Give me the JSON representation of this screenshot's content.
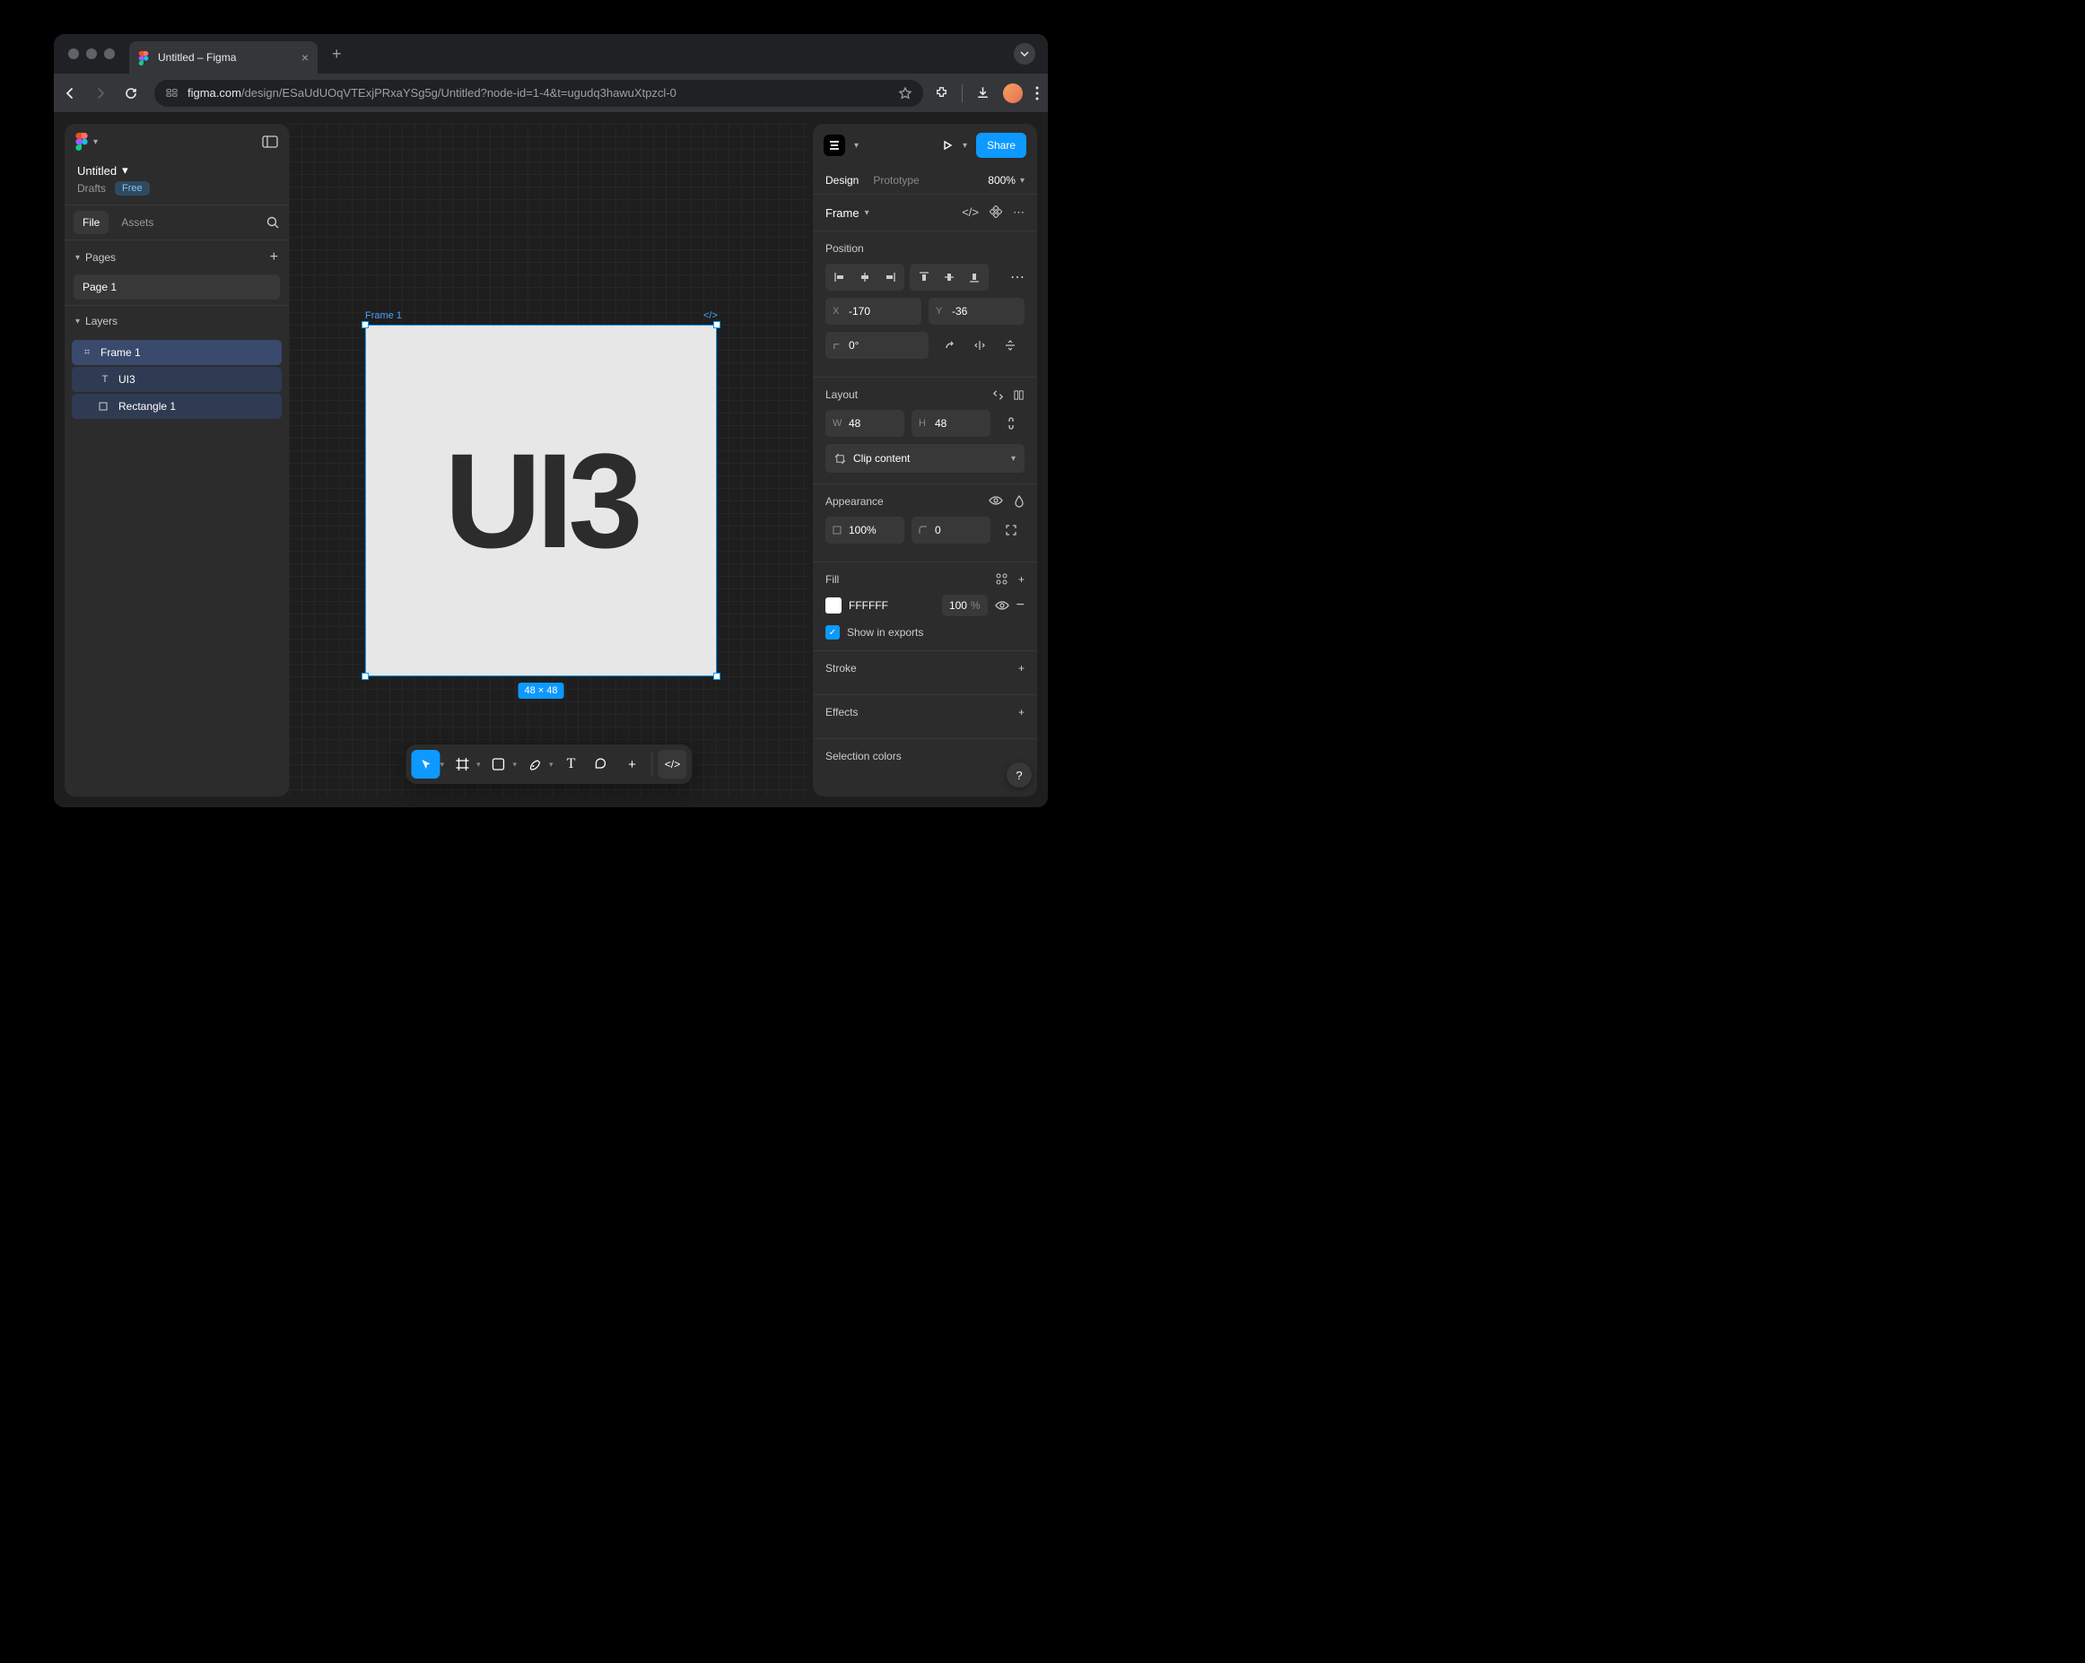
{
  "browser": {
    "tab_title": "Untitled – Figma",
    "url_prefix": "figma.com",
    "url_path": "/design/ESaUdUOqVTExjPRxaYSg5g/Untitled?node-id=1-4&t=ugudq3hawuXtpzcl-0"
  },
  "left": {
    "file_title": "Untitled",
    "drafts_label": "Drafts",
    "badge": "Free",
    "tabs": {
      "file": "File",
      "assets": "Assets"
    },
    "pages_label": "Pages",
    "page_name": "Page 1",
    "layers_label": "Layers",
    "layers": [
      {
        "name": "Frame 1",
        "type": "frame"
      },
      {
        "name": "UI3",
        "type": "text"
      },
      {
        "name": "Rectangle 1",
        "type": "rect"
      }
    ]
  },
  "canvas": {
    "frame_label": "Frame 1",
    "frame_text": "UI3",
    "dimensions": "48 × 48"
  },
  "right": {
    "share": "Share",
    "tabs": {
      "design": "Design",
      "prototype": "Prototype"
    },
    "zoom": "800%",
    "frame_name": "Frame",
    "position": {
      "label": "Position",
      "x": "-170",
      "y": "-36",
      "rotation": "0°"
    },
    "layout": {
      "label": "Layout",
      "w": "48",
      "h": "48",
      "clip": "Clip content"
    },
    "appearance": {
      "label": "Appearance",
      "opacity": "100%",
      "radius": "0"
    },
    "fill": {
      "label": "Fill",
      "hex": "FFFFFF",
      "pct": "100",
      "pct_unit": "%",
      "show_exports": "Show in exports"
    },
    "stroke_label": "Stroke",
    "effects_label": "Effects",
    "selection_colors_label": "Selection colors"
  }
}
